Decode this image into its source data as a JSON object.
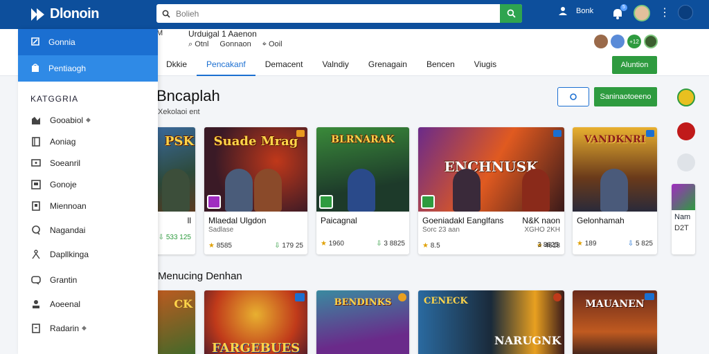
{
  "app": {
    "name": "Dlonoin"
  },
  "search": {
    "placeholder": "Bolieh"
  },
  "topbar": {
    "user_label": "Bonk",
    "notif_count": "5"
  },
  "sidebar": {
    "top_items": [
      {
        "label": "Gonnia",
        "icon": "controller-icon"
      },
      {
        "label": "Pentiaogh",
        "icon": "bag-icon"
      }
    ],
    "heading": "KATGGRIA",
    "items": [
      {
        "label": "Gooabiol",
        "icon": "chart-icon",
        "badge": "shield"
      },
      {
        "label": "Aoniag",
        "icon": "book-icon"
      },
      {
        "label": "Soeanril",
        "icon": "monitor-icon"
      },
      {
        "label": "Gonoje",
        "icon": "image-icon"
      },
      {
        "label": "Miennoan",
        "icon": "document-icon"
      },
      {
        "label": "Nagandai",
        "icon": "chat-icon"
      },
      {
        "label": "Dapllkinga",
        "icon": "person-icon"
      },
      {
        "label": "Grantin",
        "icon": "message-icon"
      },
      {
        "label": "Aoeenal",
        "icon": "user-icon"
      },
      {
        "label": "Radarin",
        "icon": "file-icon",
        "badge": "shield"
      }
    ]
  },
  "header": {
    "breadcrumb": "M",
    "title": "Urduigal 1 Aaenon",
    "meta": [
      {
        "icon": "search-icon",
        "label": "Otnl"
      },
      {
        "label": "Gonnaon"
      },
      {
        "icon": "tag-icon",
        "label": "Ooil"
      }
    ],
    "tabs": [
      "Dkkie",
      "Pencakanf",
      "Demacent",
      "Valndiy",
      "Grenagain",
      "Bencen",
      "Viugis"
    ],
    "active_tab": 1,
    "follow_label": "Aluntion",
    "avatar_badge": "+12"
  },
  "section1": {
    "title": "Bncaplah",
    "subtitle": "Xekolaoi ent",
    "action_label": "Saninaotoeeno"
  },
  "section2": {
    "title": "Menucing Denhan"
  },
  "cards_row1": [
    {
      "art": "PSK",
      "title": "ll",
      "sub": "",
      "rating": "",
      "downloads": "533 125"
    },
    {
      "art": "Suade Mrag",
      "title": "Mlaedal Ulgdon",
      "sub": "Sadlase",
      "rating": "8585",
      "downloads": "179 25"
    },
    {
      "art": "BLRNARAK",
      "title": "Paicagnal",
      "sub": "",
      "rating": "1960",
      "downloads": "3 8825"
    },
    {
      "art": "ENCHNUSK",
      "title": "Goeniadakl Eanglfans",
      "sub": "Sorc 23 aan",
      "rating": "8.5",
      "downloads": ""
    },
    {
      "art": "",
      "title": "N&K naon",
      "sub": "XGHO 2KH",
      "rating": "4618",
      "downloads": "3 8625"
    },
    {
      "art": "VANDKNRI",
      "title": "Gelonhamah",
      "sub": "",
      "rating": "189",
      "downloads": "5 825"
    },
    {
      "art": "",
      "title": "Nam",
      "sub": "D2T",
      "rating": "",
      "downloads": ""
    }
  ],
  "cards_row2": [
    {
      "art": "CK"
    },
    {
      "art": "FARGEBUES"
    },
    {
      "art": "BENDINKS"
    },
    {
      "art": "CENECK"
    },
    {
      "art": "NARUGNK"
    },
    {
      "art": "MAUANEN"
    }
  ]
}
